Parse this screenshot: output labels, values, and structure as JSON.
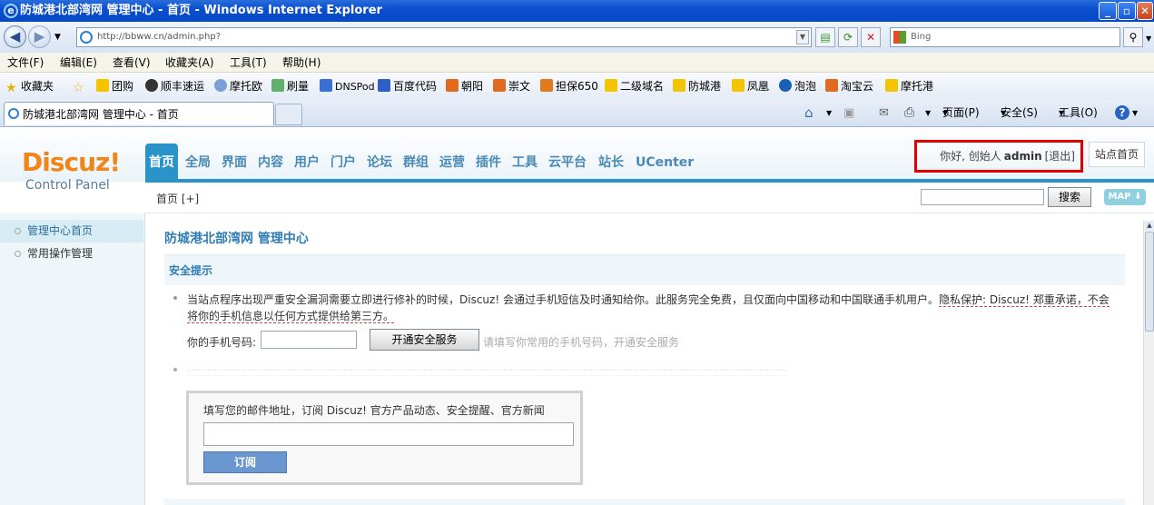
{
  "window": {
    "title": "防城港北部湾网 管理中心 - 首页 - Windows Internet Explorer",
    "icon": "ie-logo-icon"
  },
  "addressbar": {
    "url": "http://bbww.cn/admin.php?",
    "search_placeholder": "Bing"
  },
  "menubar": {
    "items": [
      "文件(F)",
      "编辑(E)",
      "查看(V)",
      "收藏夹(A)",
      "工具(T)",
      "帮助(H)"
    ]
  },
  "favorites": {
    "label": "收藏夹",
    "items": [
      "团购",
      "顺丰速运",
      "摩托欧",
      "刷量",
      "DNSPod",
      "百度代码",
      "朝阳",
      "崇文",
      "担保650",
      "二级域名",
      "防城港",
      "凤凰",
      "泡泡",
      "淘宝云",
      "摩托港"
    ]
  },
  "tab": {
    "title": "防城港北部湾网 管理中心 - 首页"
  },
  "commandbar": {
    "page": "页面(P)",
    "safety": "安全(S)",
    "tools": "工具(O)",
    "help": "?"
  },
  "logo": {
    "brand": "Discuz!",
    "sub": "Control Panel"
  },
  "topnav": {
    "items": [
      "首页",
      "全局",
      "界面",
      "内容",
      "用户",
      "门户",
      "论坛",
      "群组",
      "运营",
      "插件",
      "工具",
      "云平台",
      "站长",
      "UCenter"
    ],
    "active": "首页"
  },
  "user": {
    "greeting": "你好, 创始人",
    "name": "admin",
    "logout": "[退出]",
    "site_home": "站点首页"
  },
  "subbar": {
    "breadcrumb": "首页 [+]",
    "search_button": "搜索",
    "map_button": "MAP"
  },
  "sidebar": {
    "items": [
      "管理中心首页",
      "常用操作管理"
    ],
    "active": "管理中心首页"
  },
  "main": {
    "page_title": "防城港北部湾网 管理中心",
    "section_title": "安全提示",
    "notice_part1": "当站点程序出现严重安全漏洞需要立即进行修补的时候，Discuz! 会通过手机短信及时通知给你。此服务完全免费，且仅面向中国移动和中国联通手机用户。",
    "notice_privacy": "隐私保护: Discuz! 郑重承诺，不会将你的手机信息以任何方式提供给第三方。",
    "phone_label": "你的手机号码:",
    "phone_button": "开通安全服务",
    "phone_hint": "请填写你常用的手机号码，开通安全服务",
    "subscribe_text": "填写您的邮件地址，订阅 Discuz! 官方产品动态、安全提醒、官方新闻",
    "subscribe_button": "订阅"
  },
  "colors": {
    "accent": "#2a93c7",
    "logo": "#f08519",
    "highlight_border": "#e10000"
  }
}
